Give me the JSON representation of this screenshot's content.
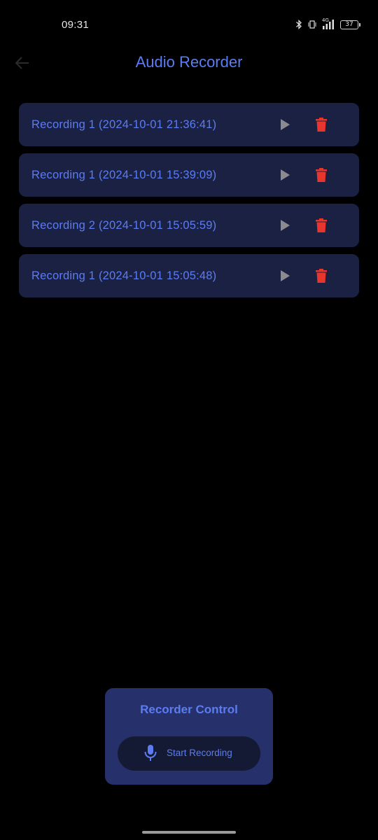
{
  "status_bar": {
    "time": "09:31",
    "network_label": "4G",
    "battery_level": "37",
    "icons": [
      "bluetooth-icon",
      "vibrate-icon",
      "signal-icon",
      "battery-icon"
    ]
  },
  "app_bar": {
    "title": "Audio Recorder",
    "back_icon": "arrow-left-icon"
  },
  "recordings": [
    {
      "label": "Recording 1 (2024-10-01 21:36:41)"
    },
    {
      "label": "Recording 1 (2024-10-01 15:39:09)"
    },
    {
      "label": "Recording 2 (2024-10-01 15:05:59)"
    },
    {
      "label": "Recording 1 (2024-10-01 15:05:48)"
    }
  ],
  "recorder_control": {
    "title": "Recorder Control",
    "button_label": "Start Recording",
    "button_icon": "microphone-icon"
  },
  "colors": {
    "background": "#000000",
    "accent": "#5c7cf2",
    "card": "#1b2142",
    "panel": "#26306a",
    "delete": "#e8362f",
    "play": "#8a8a8f"
  }
}
